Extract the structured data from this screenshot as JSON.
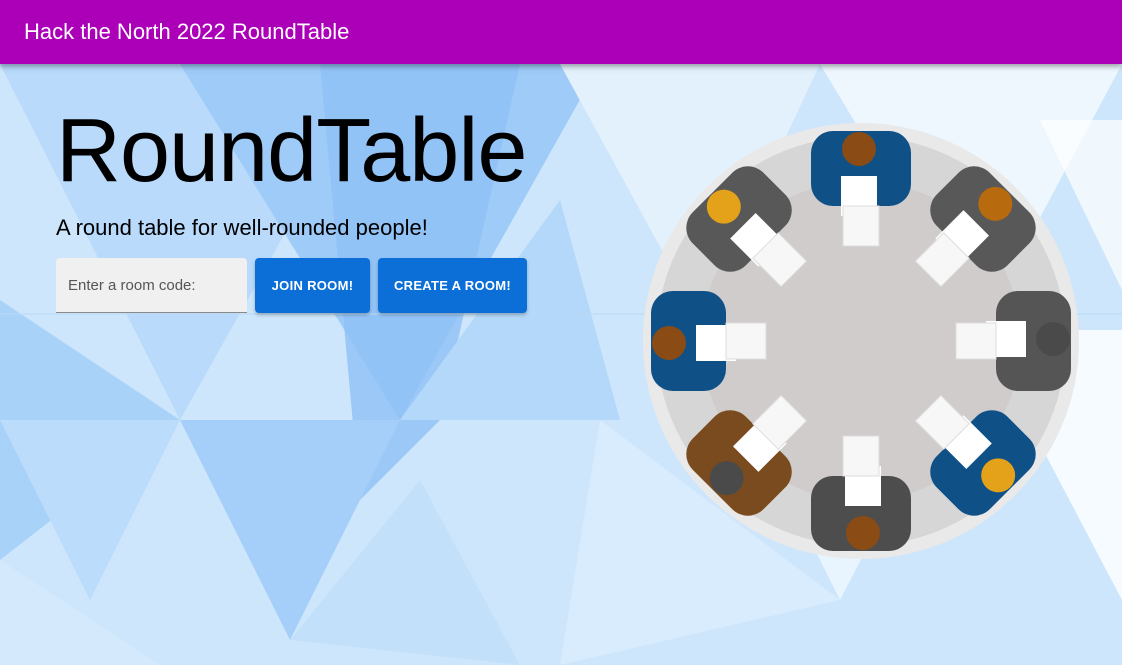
{
  "app_bar": {
    "title": "Hack the North 2022 RoundTable"
  },
  "hero": {
    "title": "RoundTable",
    "subtitle": "A round table for well-rounded people!"
  },
  "room_form": {
    "placeholder": "Enter a room code:",
    "join_label": "JOIN ROOM!",
    "create_label": "CREATE A ROOM!"
  },
  "colors": {
    "brand": "#ac00b8",
    "accent": "#0c6fd8",
    "background": "#cfe6fb"
  }
}
